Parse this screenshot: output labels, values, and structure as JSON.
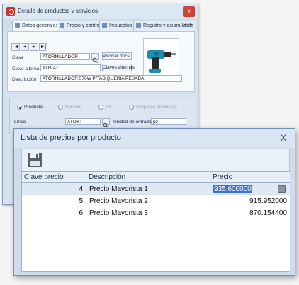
{
  "product_window": {
    "title": "Detalle de productos y servicios",
    "close_symbol": "x",
    "tabs": [
      {
        "label": "Datos generales"
      },
      {
        "label": "Precio y control"
      },
      {
        "label": "Impuestos"
      },
      {
        "label": "Registro y acumulados"
      }
    ],
    "nav_buttons": [
      "|◄",
      "◄",
      "►",
      "►|"
    ],
    "fields": {
      "clave_label": "Clave",
      "clave_value": "ATORNILLADOR",
      "clave_alterna_label": "Clave alterna",
      "clave_alterna_value": "ATR-A1",
      "descripcion_label": "Descripción",
      "descripcion_value": "ATORNILLADOR 570W P/TABIQUERIA PESADA",
      "asociar_docs_label": "Asociar docs.",
      "claves_alternas_label": "Claves alternas"
    },
    "type_options": [
      {
        "label": "Producto",
        "selected": true
      },
      {
        "label": "Servicio",
        "selected": false
      },
      {
        "label": "Kit",
        "selected": false
      },
      {
        "label": "Grupo de productos",
        "selected": false
      }
    ],
    "linea_label": "Línea",
    "linea_value": "ATOYT",
    "unidad_label": "Unidad de entrada",
    "unidad_value": "pz"
  },
  "price_window": {
    "title": "Lista de precios por producto",
    "close_symbol": "X",
    "columns": [
      "Clave precio",
      "Descripción",
      "Precio"
    ],
    "rows": [
      {
        "clave": "4",
        "descripcion": "Precio Mayorista 1",
        "precio": "935.600000",
        "selected": true
      },
      {
        "clave": "5",
        "descripcion": "Precio Mayorista 2",
        "precio": "915.952000",
        "selected": false
      },
      {
        "clave": "6",
        "descripcion": "Precio Mayorista 3",
        "precio": "870.154400",
        "selected": false
      }
    ]
  }
}
